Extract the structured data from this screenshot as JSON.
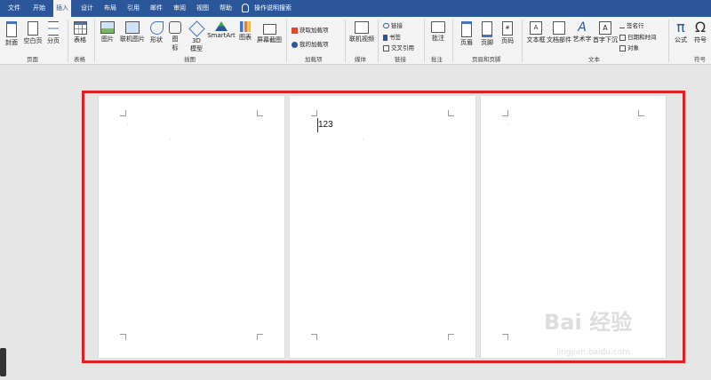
{
  "tabs": [
    "文件",
    "开始",
    "插入",
    "设计",
    "布局",
    "引用",
    "邮件",
    "审阅",
    "视图",
    "帮助"
  ],
  "active_tab": "插入",
  "tell_me": "操作说明搜索",
  "ribbon": {
    "pages": {
      "label": "页面",
      "cover": "封面",
      "blank": "空白页",
      "break": "分页"
    },
    "tables": {
      "label": "表格",
      "table": "表格"
    },
    "illustrations": {
      "label": "插图",
      "picture": "图片",
      "online_picture": "联机图片",
      "shapes": "形状",
      "icons_top": "图",
      "icons_bottom": "标",
      "model_top": "3D",
      "model_bottom": "模型",
      "smartart": "SmartArt",
      "chart": "图表",
      "screenshot": "屏幕截图"
    },
    "addins": {
      "label": "加载项",
      "get": "获取加载项",
      "mine": "我的加载项"
    },
    "media": {
      "label": "媒体",
      "online_video": "联机视频"
    },
    "links": {
      "label": "链接",
      "link": "链接",
      "bookmark": "书签",
      "crossref": "交叉引用"
    },
    "comments": {
      "label": "批注",
      "comment": "批注"
    },
    "header_footer": {
      "label": "页眉和页脚",
      "header": "页眉",
      "footer": "页脚",
      "page_number": "页码"
    },
    "text": {
      "label": "文本",
      "textbox": "文本框",
      "quickparts": "文档部件",
      "wordart": "艺术字",
      "dropcap": "首字下沉",
      "signature": "签名行",
      "datetime": "日期和时间",
      "object": "对象"
    },
    "symbols": {
      "label": "符号",
      "equation_glyph": "π",
      "equation": "公式",
      "symbol_glyph": "Ω",
      "symbol": "符号"
    }
  },
  "document": {
    "page2_text": "123",
    "watermark": "Bai 经验",
    "watermark_url": "jingyan.baidu.com"
  },
  "colors": {
    "title_bar": "#2b579a",
    "highlight": "#e02020"
  }
}
